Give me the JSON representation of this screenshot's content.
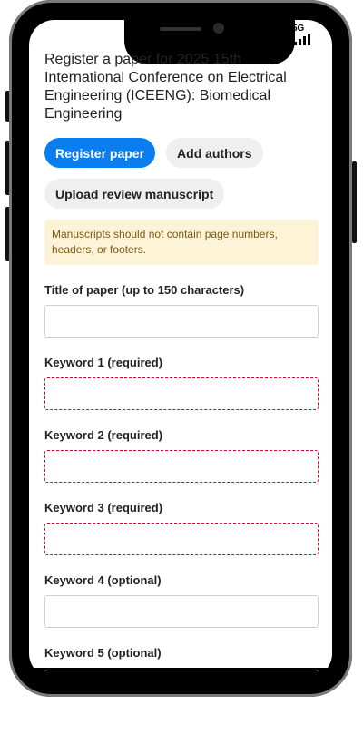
{
  "status_bar": {
    "network": "5G"
  },
  "page": {
    "title": "Register a paper for 2025 15th International Conference on Electrical Engineering (ICEENG): Biomedical Engineering"
  },
  "tabs": [
    {
      "label": "Register paper",
      "active": true
    },
    {
      "label": "Add authors",
      "active": false
    },
    {
      "label": "Upload review manuscript",
      "active": false
    }
  ],
  "notice": "Manuscripts should not contain page numbers, headers, or footers.",
  "fields": {
    "title": {
      "label": "Title of paper (up to 150 characters)",
      "value": ""
    },
    "keyword1": {
      "label": "Keyword 1 (required)",
      "value": ""
    },
    "keyword2": {
      "label": "Keyword 2 (required)",
      "value": ""
    },
    "keyword3": {
      "label": "Keyword 3 (required)",
      "value": ""
    },
    "keyword4": {
      "label": "Keyword 4 (optional)",
      "value": ""
    },
    "keyword5": {
      "label": "Keyword 5 (optional)",
      "value": ""
    }
  },
  "colors": {
    "accent": "#0a7df0",
    "error_border": "#e3001b",
    "notice_bg": "#fdf3d6",
    "notice_text": "#7a5a17"
  }
}
